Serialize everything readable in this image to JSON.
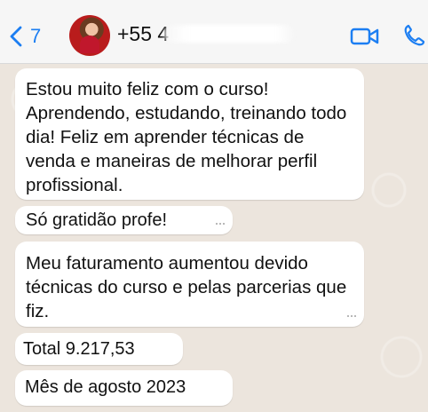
{
  "header": {
    "back_count": "7",
    "contact_prefix": "+55 4",
    "video_icon": "video-camera-icon",
    "phone_icon": "phone-icon",
    "back_icon": "chevron-left-icon"
  },
  "colors": {
    "accent": "#1c7ef2",
    "chat_background": "#ece5dd",
    "bubble": "#ffffff"
  },
  "messages": [
    {
      "text": "Estou muito feliz com o curso!\nAprendendo, estudando, treinando todo\ndia! Feliz em aprender técnicas de\nvenda e maneiras de melhorar perfil\nprofissional."
    },
    {
      "text": "Só gratidão profe!"
    },
    {
      "text": "Meu faturamento aumentou devido\ntécnicas do curso e pelas parcerias que\nfiz."
    },
    {
      "text": "Total 9.217,53"
    },
    {
      "text": "Mês de agosto 2023"
    }
  ]
}
